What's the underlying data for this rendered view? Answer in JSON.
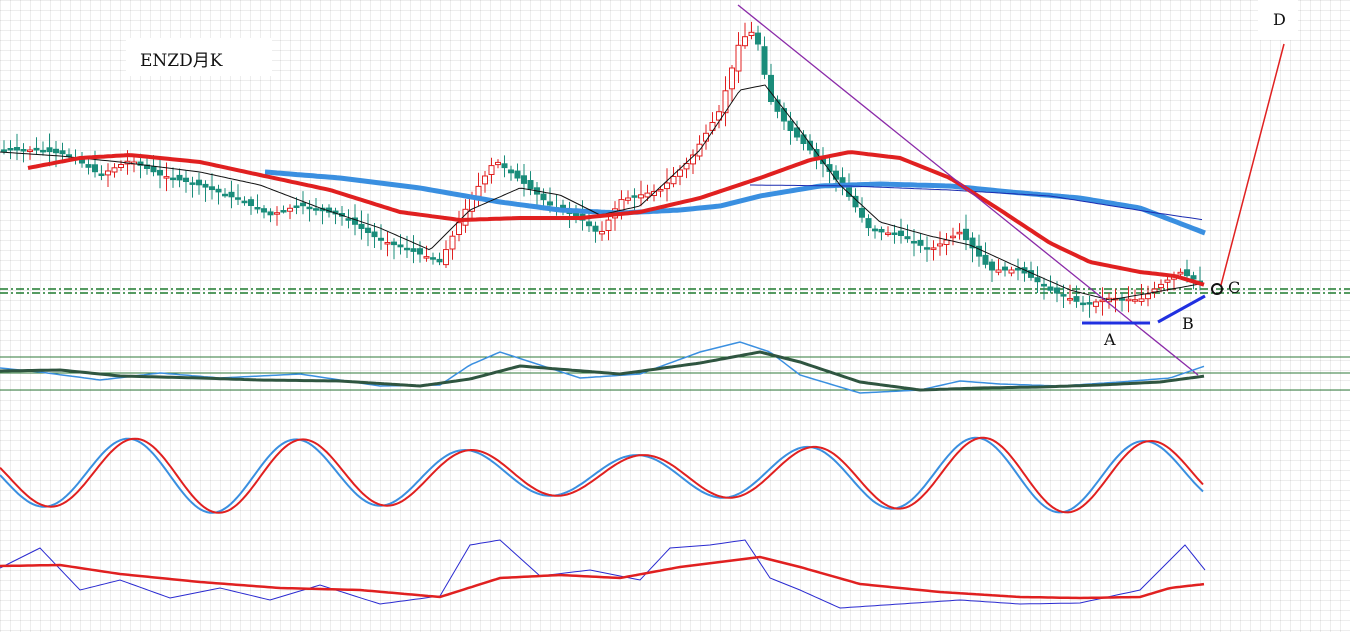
{
  "chart_data": [
    {
      "type": "candlestick",
      "title": "ENZD月K",
      "series": [
        {
          "indicator": "moving_average",
          "color": "#e02020",
          "style": "thick"
        },
        {
          "indicator": "moving_average",
          "color": "#3a8fe0",
          "style": "thick"
        },
        {
          "indicator": "moving_average",
          "color": "#111111",
          "style": "thin"
        },
        {
          "indicator": "moving_average",
          "color": "#1a2ab0",
          "style": "thin"
        }
      ],
      "candle_colors": {
        "up": "#e02020",
        "down": "#1a8c7a"
      },
      "annotations": [
        {
          "label": "A",
          "kind": "horizontal-segment",
          "color": "#2030e0"
        },
        {
          "label": "B",
          "kind": "rising-segment",
          "color": "#2030e0"
        },
        {
          "label": "C",
          "kind": "circle-marker",
          "color": "#111111"
        },
        {
          "label": "D",
          "kind": "projection-line",
          "color": "#e02020"
        },
        {
          "label": "",
          "kind": "downtrend-line",
          "color": "#8a2aa8"
        },
        {
          "label": "",
          "kind": "support-level",
          "color": "#1f7a2e",
          "style": "dash-dot"
        }
      ],
      "grid": true
    },
    {
      "type": "line",
      "series": [
        {
          "color": "#3a8fe0",
          "style": "thin"
        },
        {
          "color": "#2f5540",
          "style": "thick"
        }
      ],
      "reference_lines": 3
    },
    {
      "type": "line",
      "series": [
        {
          "color": "#3a8fe0"
        },
        {
          "color": "#e02020"
        }
      ]
    },
    {
      "type": "line",
      "series": [
        {
          "color": "#2a2ad0",
          "style": "thin"
        },
        {
          "color": "#e02020",
          "style": "thick"
        }
      ]
    }
  ]
}
